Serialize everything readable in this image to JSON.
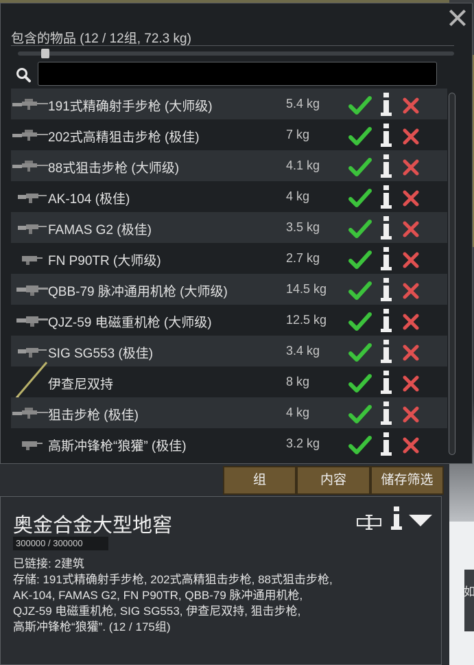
{
  "panel": {
    "title": "包含的物品 (12 / 12组, 72.3 kg)",
    "search": {
      "value": "",
      "placeholder": ""
    },
    "items": [
      {
        "name": "191式精确射手步枪 (大师级)",
        "weight": "5.4 kg",
        "icon": "sniper-rifle-icon"
      },
      {
        "name": "202式高精狙击步枪 (极佳)",
        "weight": "7 kg",
        "icon": "sniper-rifle-icon"
      },
      {
        "name": "88式狙击步枪 (大师级)",
        "weight": "4.1 kg",
        "icon": "sniper-rifle-icon"
      },
      {
        "name": "AK-104 (极佳)",
        "weight": "4 kg",
        "icon": "assault-rifle-icon"
      },
      {
        "name": "FAMAS G2 (极佳)",
        "weight": "3.5 kg",
        "icon": "assault-rifle-icon"
      },
      {
        "name": "FN P90TR (大师级)",
        "weight": "2.7 kg",
        "icon": "smg-icon"
      },
      {
        "name": "QBB-79 脉冲通用机枪 (大师级)",
        "weight": "14.5 kg",
        "icon": "machine-gun-icon"
      },
      {
        "name": "QJZ-59 电磁重机枪 (大师级)",
        "weight": "12.5 kg",
        "icon": "machine-gun-icon"
      },
      {
        "name": "SIG SG553 (极佳)",
        "weight": "3.4 kg",
        "icon": "assault-rifle-icon"
      },
      {
        "name": "伊查尼双持",
        "weight": "8 kg",
        "icon": "sword-icon"
      },
      {
        "name": "狙击步枪 (极佳)",
        "weight": "4 kg",
        "icon": "sniper-rifle-icon"
      },
      {
        "name": "高斯冲锋枪“狼獾” (极佳)",
        "weight": "3.2 kg",
        "icon": "smg-icon"
      }
    ]
  },
  "tabs": {
    "group": "组",
    "contents": "内容",
    "storage_filter": "储存筛选"
  },
  "inspect": {
    "title": "奥金合金大型地窖",
    "hp": "300000 / 300000",
    "line1": "已链接: 2建筑",
    "line2": "存储: 191式精确射手步枪, 202式高精狙击步枪, 88式狙击步枪,\nAK-104, FAMAS G2, FN P90TR, QBB-79 脉冲通用机枪,\nQJZ-59 电磁重机枪, SIG SG553, 伊查尼双持, 狙击步枪,\n高斯冲锋枪“狼獾”. (12 / 175组)"
  },
  "peek_text": "如",
  "colors": {
    "check": "#3cc23c",
    "remove": "#e05050",
    "tab": "#6b5630"
  }
}
